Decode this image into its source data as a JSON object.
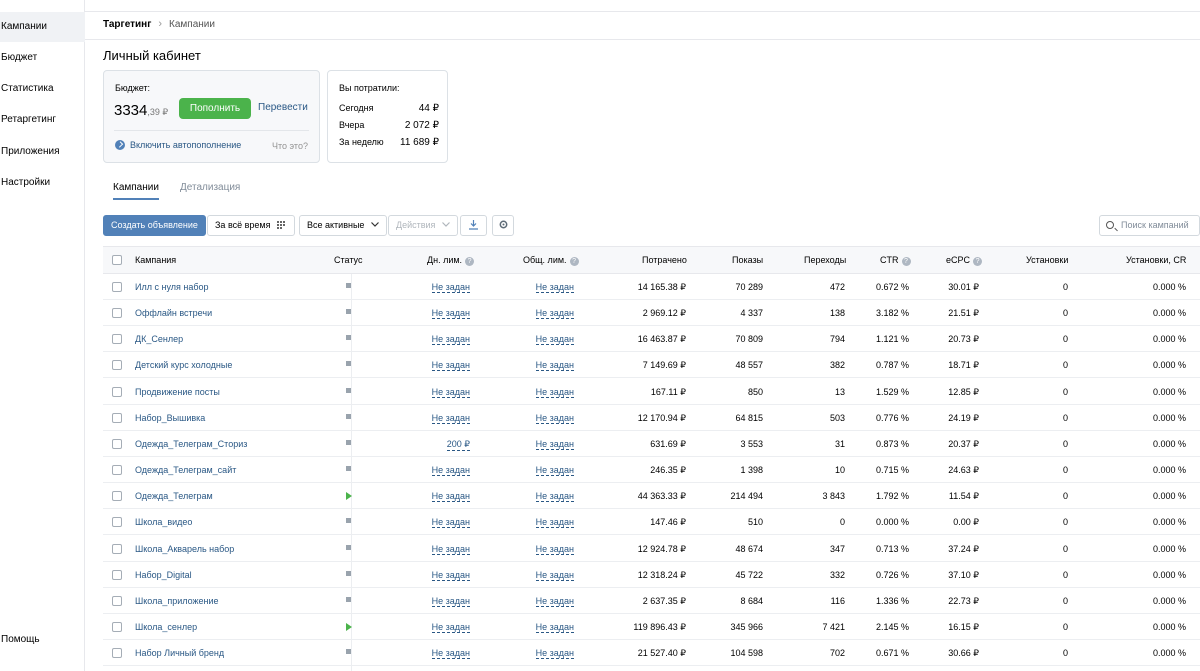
{
  "sidebar": {
    "items": [
      {
        "label": "Кампании",
        "active": true
      },
      {
        "label": "Бюджет"
      },
      {
        "label": "Статистика"
      },
      {
        "label": "Ретаргетинг"
      },
      {
        "label": "Приложения"
      },
      {
        "label": "Настройки"
      }
    ],
    "help_label": "Помощь"
  },
  "breadcrumb": {
    "first": "Таргетинг",
    "separator": "›",
    "second": "Кампании"
  },
  "page_title": "Личный кабинет",
  "budget": {
    "label": "Бюджет:",
    "amount": "3334",
    "kopecks": ",39 ₽",
    "topup_button": "Пополнить",
    "transfer_link": "Перевести",
    "autorefill_label": "Включить автопополнение",
    "what_is": "Что это?"
  },
  "spent": {
    "title": "Вы потратили:",
    "rows": [
      {
        "label": "Сегодня",
        "value": "44 ₽"
      },
      {
        "label": "Вчера",
        "value": "2 072 ₽"
      },
      {
        "label": "За неделю",
        "value": "11 689 ₽"
      }
    ]
  },
  "tabs": {
    "campaigns": "Кампании",
    "details": "Детализация"
  },
  "toolbar": {
    "create_ad": "Создать объявление",
    "period": "За всё время",
    "filter": "Все активные",
    "actions": "Действия",
    "search_placeholder": "Поиск кампаний"
  },
  "table": {
    "headers": {
      "campaign": "Кампания",
      "status": "Статус",
      "daily_limit": "Дн. лим.",
      "total_limit": "Общ. лим.",
      "spent": "Потрачено",
      "impressions": "Показы",
      "clicks": "Переходы",
      "ctr": "CTR",
      "ecpc": "eCPC",
      "installs": "Установки",
      "install_cr": "Установки, CR"
    },
    "rows": [
      {
        "name": "Илл с нуля набор",
        "status": "stopped",
        "daily": "Не задан",
        "total": "Не задан",
        "spent": "14 165.38 ₽",
        "impr": "70 289",
        "clicks": "472",
        "ctr": "0.672 %",
        "ecpc": "30.01 ₽",
        "inst": "0",
        "cr": "0.000 %"
      },
      {
        "name": "Оффлайн встречи",
        "status": "stopped",
        "daily": "Не задан",
        "total": "Не задан",
        "spent": "2 969.12 ₽",
        "impr": "4 337",
        "clicks": "138",
        "ctr": "3.182 %",
        "ecpc": "21.51 ₽",
        "inst": "0",
        "cr": "0.000 %"
      },
      {
        "name": "ДК_Сенлер",
        "status": "stopped",
        "daily": "Не задан",
        "total": "Не задан",
        "spent": "16 463.87 ₽",
        "impr": "70 809",
        "clicks": "794",
        "ctr": "1.121 %",
        "ecpc": "20.73 ₽",
        "inst": "0",
        "cr": "0.000 %"
      },
      {
        "name": "Детский курс холодные",
        "status": "stopped",
        "daily": "Не задан",
        "total": "Не задан",
        "spent": "7 149.69 ₽",
        "impr": "48 557",
        "clicks": "382",
        "ctr": "0.787 %",
        "ecpc": "18.71 ₽",
        "inst": "0",
        "cr": "0.000 %"
      },
      {
        "name": "Продвижение посты",
        "status": "stopped",
        "daily": "Не задан",
        "total": "Не задан",
        "spent": "167.11 ₽",
        "impr": "850",
        "clicks": "13",
        "ctr": "1.529 %",
        "ecpc": "12.85 ₽",
        "inst": "0",
        "cr": "0.000 %"
      },
      {
        "name": "Набор_Вышивка",
        "status": "stopped",
        "daily": "Не задан",
        "total": "Не задан",
        "spent": "12 170.94 ₽",
        "impr": "64 815",
        "clicks": "503",
        "ctr": "0.776 %",
        "ecpc": "24.19 ₽",
        "inst": "0",
        "cr": "0.000 %"
      },
      {
        "name": "Одежда_Телеграм_Сториз",
        "status": "stopped",
        "daily": "200 ₽",
        "total": "Не задан",
        "spent": "631.69 ₽",
        "impr": "3 553",
        "clicks": "31",
        "ctr": "0.873 %",
        "ecpc": "20.37 ₽",
        "inst": "0",
        "cr": "0.000 %"
      },
      {
        "name": "Одежда_Телеграм_сайт",
        "status": "stopped",
        "daily": "Не задан",
        "total": "Не задан",
        "spent": "246.35 ₽",
        "impr": "1 398",
        "clicks": "10",
        "ctr": "0.715 %",
        "ecpc": "24.63 ₽",
        "inst": "0",
        "cr": "0.000 %"
      },
      {
        "name": "Одежда_Телеграм",
        "status": "active",
        "daily": "Не задан",
        "total": "Не задан",
        "spent": "44 363.33 ₽",
        "impr": "214 494",
        "clicks": "3 843",
        "ctr": "1.792 %",
        "ecpc": "11.54 ₽",
        "inst": "0",
        "cr": "0.000 %"
      },
      {
        "name": "Школа_видео",
        "status": "stopped",
        "daily": "Не задан",
        "total": "Не задан",
        "spent": "147.46 ₽",
        "impr": "510",
        "clicks": "0",
        "ctr": "0.000 %",
        "ecpc": "0.00 ₽",
        "inst": "0",
        "cr": "0.000 %"
      },
      {
        "name": "Школа_Акварель набор",
        "status": "stopped",
        "daily": "Не задан",
        "total": "Не задан",
        "spent": "12 924.78 ₽",
        "impr": "48 674",
        "clicks": "347",
        "ctr": "0.713 %",
        "ecpc": "37.24 ₽",
        "inst": "0",
        "cr": "0.000 %"
      },
      {
        "name": "Набор_Digital",
        "status": "stopped",
        "daily": "Не задан",
        "total": "Не задан",
        "spent": "12 318.24 ₽",
        "impr": "45 722",
        "clicks": "332",
        "ctr": "0.726 %",
        "ecpc": "37.10 ₽",
        "inst": "0",
        "cr": "0.000 %"
      },
      {
        "name": "Школа_приложение",
        "status": "stopped",
        "daily": "Не задан",
        "total": "Не задан",
        "spent": "2 637.35 ₽",
        "impr": "8 684",
        "clicks": "116",
        "ctr": "1.336 %",
        "ecpc": "22.73 ₽",
        "inst": "0",
        "cr": "0.000 %"
      },
      {
        "name": "Школа_сенлер",
        "status": "active",
        "daily": "Не задан",
        "total": "Не задан",
        "spent": "119 896.43 ₽",
        "impr": "345 966",
        "clicks": "7 421",
        "ctr": "2.145 %",
        "ecpc": "16.15 ₽",
        "inst": "0",
        "cr": "0.000 %"
      },
      {
        "name": "Набор Личный бренд",
        "status": "stopped",
        "daily": "Не задан",
        "total": "Не задан",
        "spent": "21 527.40 ₽",
        "impr": "104 598",
        "clicks": "702",
        "ctr": "0.671 %",
        "ecpc": "30.66 ₽",
        "inst": "0",
        "cr": "0.000 %"
      }
    ]
  },
  "colors": {
    "accent": "#5181b8",
    "link": "#2a5885",
    "green": "#4bb34b"
  }
}
